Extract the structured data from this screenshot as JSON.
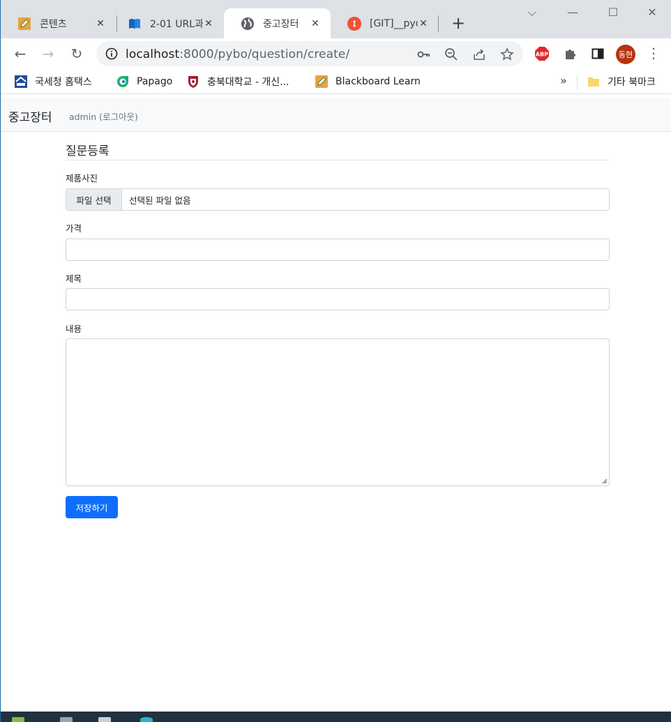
{
  "browser": {
    "tabs": [
      {
        "title": "콘텐츠",
        "close": "✕",
        "favicon": "pencil-icon"
      },
      {
        "title": "2-01 URL과",
        "close": "✕",
        "favicon": "book-icon"
      },
      {
        "title": "중고장터",
        "close": "✕",
        "favicon": "globe-icon",
        "active": true
      },
      {
        "title": "[GIT]__pycc",
        "close": "✕",
        "favicon": "git-icon"
      }
    ],
    "new_tab": "+",
    "window_controls": {
      "tab_search": "⌵",
      "minimize": "—",
      "maximize": "☐",
      "close": "✕"
    },
    "nav": {
      "back": "←",
      "forward": "→",
      "reload": "↻"
    },
    "url_host": "localhost",
    "url_path": ":8000/pybo/question/create/",
    "extensions": {
      "abp_label": "ABP",
      "profile_initials": "동현",
      "menu": "⋮"
    },
    "bookmarks": [
      {
        "label": "국세청 홈택스",
        "icon": "hometax-icon"
      },
      {
        "label": "Papago",
        "icon": "papago-icon"
      },
      {
        "label": "충북대학교 - 개신...",
        "icon": "cbnu-shield-icon"
      },
      {
        "label": "Blackboard Learn",
        "icon": "pencil-icon"
      }
    ],
    "bookmarks_overflow": "»",
    "other_bookmarks": "기타 북마크"
  },
  "page": {
    "brand": "중고장터",
    "user_link": "admin (로그아웃)",
    "form_title": "질문등록",
    "photo_label": "제품사진",
    "file_button": "파일 선택",
    "file_status": "선택된 파일 없음",
    "price_label": "가격",
    "price_value": "",
    "subject_label": "제목",
    "subject_value": "",
    "content_label": "내용",
    "content_value": "",
    "submit_label": "저장하기"
  },
  "colors": {
    "primary": "#0d6efd",
    "navbar_bg": "#f8f9fa",
    "tabstrip_bg": "#dee1e6",
    "avatar_bg": "#b5330f"
  }
}
